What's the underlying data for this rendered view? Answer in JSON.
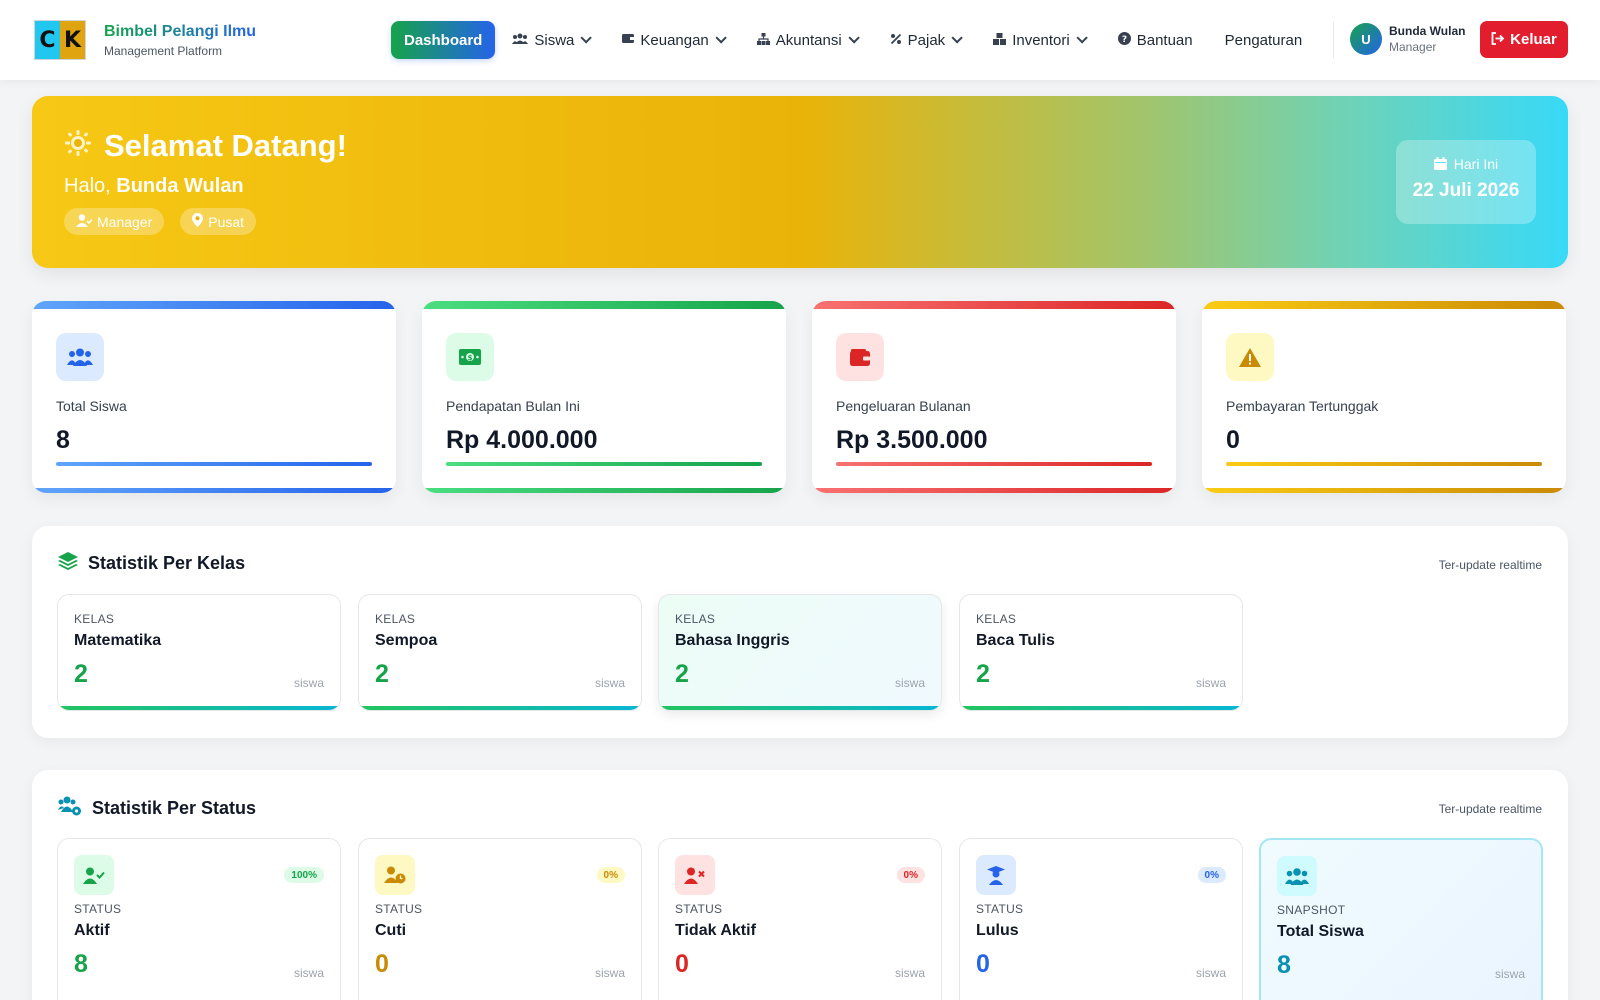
{
  "brand": {
    "logo_left": "C",
    "logo_right": "K",
    "name": "Bimbel Pelangi Ilmu",
    "subtitle": "Management Platform"
  },
  "nav": {
    "dashboard": "Dashboard",
    "siswa": "Siswa",
    "keuangan": "Keuangan",
    "akuntansi": "Akuntansi",
    "pajak": "Pajak",
    "inventori": "Inventori",
    "bantuan": "Bantuan",
    "pengaturan": "Pengaturan"
  },
  "user": {
    "initial": "U",
    "name": "Bunda Wulan",
    "role": "Manager",
    "logout": "Keluar"
  },
  "hero": {
    "title": "Selamat Datang!",
    "greeting_prefix": "Halo, ",
    "greeting_name": "Bunda Wulan",
    "tag_role": "Manager",
    "tag_location": "Pusat",
    "date_label": "Hari Ini",
    "date_value": "22 Juli 2026"
  },
  "stats": [
    {
      "label": "Total Siswa",
      "value": "8",
      "color": "#2563eb",
      "icon": "users-icon"
    },
    {
      "label": "Pendapatan Bulan Ini",
      "value": "Rp 4.000.000",
      "color": "#16a34a",
      "icon": "money-icon"
    },
    {
      "label": "Pengeluaran Bulanan",
      "value": "Rp 3.500.000",
      "color": "#dc2626",
      "icon": "wallet-icon"
    },
    {
      "label": "Pembayaran Tertunggak",
      "value": "0",
      "color": "#ca8a04",
      "icon": "warning-icon"
    }
  ],
  "kelas_section": {
    "title": "Statistik Per Kelas",
    "note": "Ter-update realtime",
    "items": [
      {
        "label": "KELAS",
        "name": "Matematika",
        "count": "2",
        "unit": "siswa"
      },
      {
        "label": "KELAS",
        "name": "Sempoa",
        "count": "2",
        "unit": "siswa"
      },
      {
        "label": "KELAS",
        "name": "Bahasa Inggris",
        "count": "2",
        "unit": "siswa"
      },
      {
        "label": "KELAS",
        "name": "Baca Tulis",
        "count": "2",
        "unit": "siswa"
      }
    ]
  },
  "status_section": {
    "title": "Statistik Per Status",
    "note": "Ter-update realtime",
    "items": [
      {
        "label": "STATUS",
        "name": "Aktif",
        "count": "8",
        "unit": "siswa",
        "badge": "100%",
        "color": "#16a34a"
      },
      {
        "label": "STATUS",
        "name": "Cuti",
        "count": "0",
        "unit": "siswa",
        "badge": "0%",
        "color": "#ca8a04"
      },
      {
        "label": "STATUS",
        "name": "Tidak Aktif",
        "count": "0",
        "unit": "siswa",
        "badge": "0%",
        "color": "#dc2626"
      },
      {
        "label": "STATUS",
        "name": "Lulus",
        "count": "0",
        "unit": "siswa",
        "badge": "0%",
        "color": "#2563eb"
      },
      {
        "label": "SNAPSHOT",
        "name": "Total Siswa",
        "count": "8",
        "unit": "siswa",
        "color": "#0891b2"
      }
    ]
  }
}
